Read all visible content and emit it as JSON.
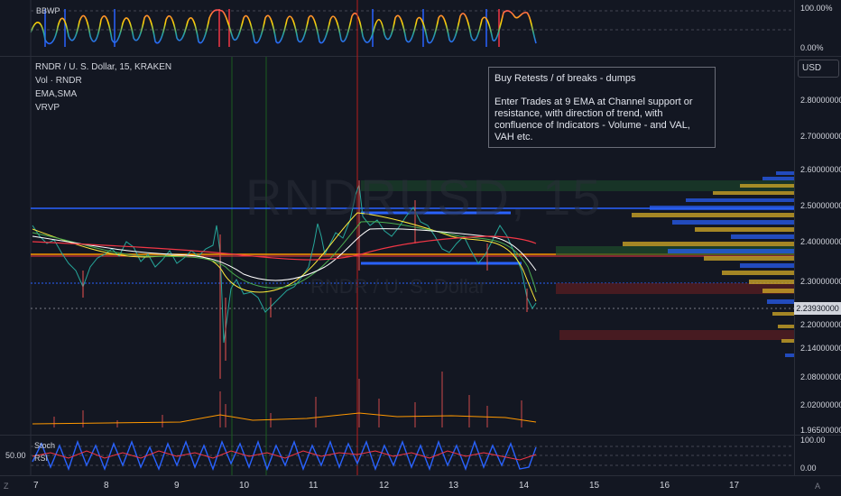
{
  "symbol_watermark": "RNDRUSD, 15",
  "symbol_watermark_sub": "RNDR / U. S. Dollar",
  "bbwp": {
    "title": "BBWP",
    "scale_top": "100.00%",
    "scale_bottom": "0.00%"
  },
  "main": {
    "legend_title": "RNDR / U. S. Dollar, 15, KRAKEN",
    "indicators": [
      "Vol · RNDR",
      "EMA,SMA",
      "VRVP"
    ],
    "currency_button": "USD",
    "last_price": "2.23930000",
    "price_ticks": [
      "2.80000000",
      "2.70000000",
      "2.60000000",
      "2.50000000",
      "2.40000000",
      "2.30000000",
      "2.20000000",
      "2.14000000",
      "2.08000000",
      "2.02000000",
      "1.96500000"
    ],
    "note": {
      "heading": "Buy Retests / of breaks - dumps",
      "body": "Enter Trades at 9 EMA at Channel support or resistance, with direction of trend, with confluence of Indicators - Volume - and VAL, VAH etc."
    }
  },
  "oscillator": {
    "labels": [
      "Stoch",
      "RSI"
    ],
    "left_value": "50.00",
    "scale_top": "100.00",
    "scale_bottom": "0.00"
  },
  "time_axis": {
    "ticks": [
      "7",
      "8",
      "9",
      "10",
      "11",
      "12",
      "13",
      "14",
      "15",
      "16",
      "17"
    ]
  },
  "corner_buttons": {
    "zoom": "Z",
    "auto": "A"
  },
  "colors": {
    "background": "#131722",
    "blue_line": "#2962ff",
    "orange_line": "#ff9800",
    "red_line": "#f23645",
    "vol_profile_blue": "#2962ff",
    "vol_profile_gold": "#c9a227",
    "green_zone": "#1e4d2b",
    "red_zone": "#5a1e22"
  }
}
